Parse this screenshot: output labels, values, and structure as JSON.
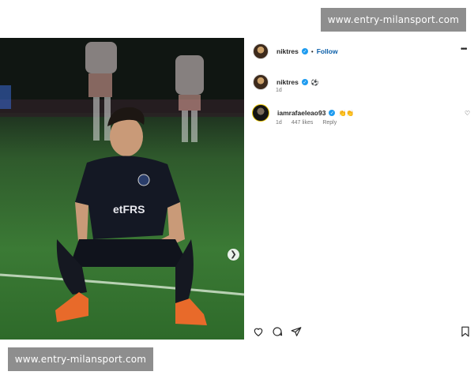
{
  "watermark": {
    "text": "www.entry-milansport.com"
  },
  "post": {
    "author": "niktres",
    "follow_label": "Follow",
    "more_label": "•••",
    "caption_user": "niktres",
    "caption_emoji": "⚽",
    "caption_time": "1d"
  },
  "comment": {
    "user": "iamrafaeleao93",
    "emoji": "👏👏",
    "time": "1d",
    "likes": "447 likes",
    "reply": "Reply"
  },
  "photo": {
    "kit_text": "etFRS"
  },
  "icons": [
    "heart-icon",
    "comment-icon",
    "share-icon",
    "bookmark-icon",
    "verified-icon",
    "chevron-right-icon"
  ]
}
